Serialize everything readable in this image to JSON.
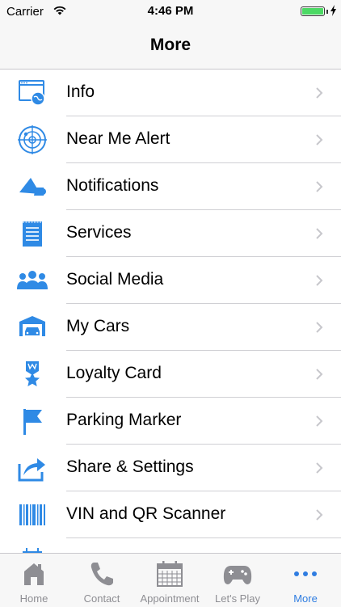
{
  "status": {
    "carrier": "Carrier",
    "time": "4:46 PM",
    "battery_level": 1.0
  },
  "header": {
    "title": "More"
  },
  "colors": {
    "accent": "#2f7de1",
    "icon_blue": "#2f8ae5",
    "tab_gray": "#8e8e93",
    "battery_green": "#4cd964"
  },
  "menu": [
    {
      "label": "Info",
      "icon": "info-window-icon"
    },
    {
      "label": "Near Me Alert",
      "icon": "radar-icon"
    },
    {
      "label": "Notifications",
      "icon": "megaphone-icon"
    },
    {
      "label": "Services",
      "icon": "notepad-icon"
    },
    {
      "label": "Social Media",
      "icon": "people-group-icon"
    },
    {
      "label": "My Cars",
      "icon": "garage-car-icon"
    },
    {
      "label": "Loyalty Card",
      "icon": "loyalty-badge-icon"
    },
    {
      "label": "Parking Marker",
      "icon": "flag-icon"
    },
    {
      "label": "Share & Settings",
      "icon": "share-arrow-icon"
    },
    {
      "label": "VIN and QR Scanner",
      "icon": "barcode-icon"
    }
  ],
  "tabs": [
    {
      "label": "Home",
      "icon": "home-icon",
      "active": false
    },
    {
      "label": "Contact",
      "icon": "phone-icon",
      "active": false
    },
    {
      "label": "Appointment",
      "icon": "calendar-icon",
      "active": false
    },
    {
      "label": "Let's Play",
      "icon": "gamepad-icon",
      "active": false
    },
    {
      "label": "More",
      "icon": "more-dots-icon",
      "active": true
    }
  ]
}
